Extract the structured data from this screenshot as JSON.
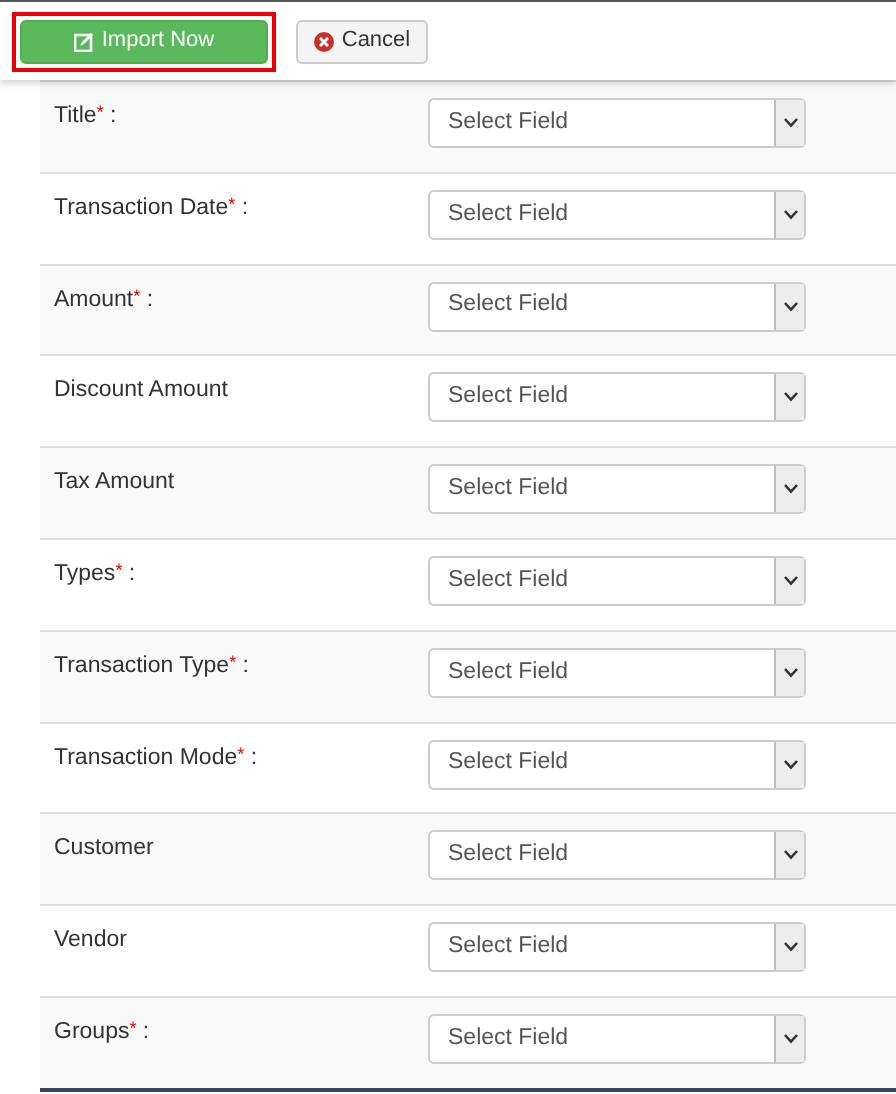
{
  "buttons": [
    {
      "kind": "primary",
      "label": "Import Now",
      "highlighted": true
    },
    {
      "kind": "cancel",
      "label": "Cancel",
      "highlighted": false
    }
  ],
  "fields": [
    {
      "label": "Title",
      "required_mark": "*",
      "suffix": " :",
      "placeholder": "Select Field"
    },
    {
      "label": "Transaction Date",
      "required_mark": "*",
      "suffix": " :",
      "placeholder": "Select Field"
    },
    {
      "label": "Amount",
      "required_mark": "*",
      "suffix": " :",
      "placeholder": "Select Field"
    },
    {
      "label": "Discount Amount",
      "placeholder": "Select Field"
    },
    {
      "label": "Tax Amount",
      "placeholder": "Select Field"
    },
    {
      "label": "Types",
      "required_mark": "*",
      "suffix": " :",
      "placeholder": "Select Field"
    },
    {
      "label": "Transaction Type",
      "required_mark": "*",
      "suffix": " :",
      "placeholder": "Select Field"
    },
    {
      "label": "Transaction Mode",
      "required_mark": "*",
      "suffix": " :",
      "placeholder": "Select Field"
    },
    {
      "label": "Customer",
      "placeholder": "Select Field"
    },
    {
      "label": "Vendor",
      "placeholder": "Select Field"
    },
    {
      "label": "Groups",
      "required_mark": "*",
      "suffix": " :",
      "placeholder": "Select Field"
    }
  ]
}
